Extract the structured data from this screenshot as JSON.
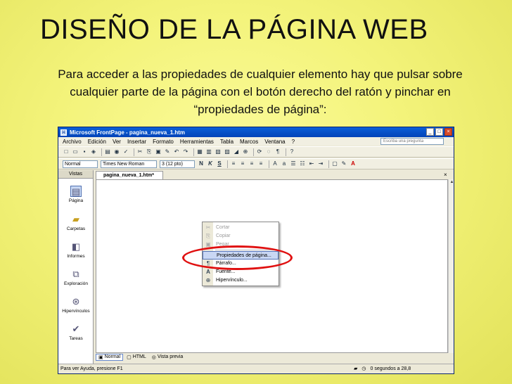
{
  "slide": {
    "title": "DISEÑO DE LA PÁGINA WEB",
    "text": "Para acceder a las propiedades de cualquier elemento hay que pulsar sobre cualquier parte de la página con el botón derecho del ratón y pinchar en “propiedades de página”:"
  },
  "window": {
    "title": "Microsoft FrontPage - pagina_nueva_1.htm",
    "min": "_",
    "max": "□",
    "close": "×"
  },
  "menubar": {
    "items": [
      "Archivo",
      "Edición",
      "Ver",
      "Insertar",
      "Formato",
      "Herramientas",
      "Tabla",
      "Marcos",
      "Ventana",
      "?"
    ],
    "ask_placeholder": "Escriba una pregunta"
  },
  "format_toolbar": {
    "style": "Normal",
    "font": "Times New Roman",
    "size": "3 (12 pto)",
    "bold": "N",
    "italic": "K",
    "underline": "S"
  },
  "views_panel": {
    "header": "Vistas",
    "items": [
      {
        "label": "Página",
        "icon": "page-view-icon",
        "glyph": "▤"
      },
      {
        "label": "Carpetas",
        "icon": "folders-view-icon",
        "glyph": "▰"
      },
      {
        "label": "Informes",
        "icon": "reports-view-icon",
        "glyph": "◧"
      },
      {
        "label": "Exploración",
        "icon": "navigation-view-icon",
        "glyph": "⧉"
      },
      {
        "label": "Hipervínculos",
        "icon": "hyperlinks-view-icon",
        "glyph": "⊛"
      },
      {
        "label": "Tareas",
        "icon": "tasks-view-icon",
        "glyph": "✔"
      }
    ]
  },
  "document": {
    "tab": "pagina_nueva_1.htm*",
    "close": "×"
  },
  "view_tabs": [
    "Normal",
    "HTML",
    "Vista previa"
  ],
  "status": {
    "left": "Para ver Ayuda, presione F1",
    "time": "0 segundos a 28,8"
  },
  "context_menu": {
    "items": [
      {
        "label": "Cortar",
        "icon": "scissors-icon",
        "glyph": "✂",
        "disabled": true
      },
      {
        "label": "Copiar",
        "icon": "copy-icon",
        "glyph": "⎘",
        "disabled": true
      },
      {
        "label": "Pegar",
        "icon": "paste-icon",
        "glyph": "▣",
        "disabled": true
      },
      {
        "label": "Propiedades de página...",
        "icon": "page-properties-icon",
        "glyph": "",
        "highlighted": true
      },
      {
        "label": "Párrafo...",
        "icon": "paragraph-icon",
        "glyph": "¶"
      },
      {
        "label": "Fuente...",
        "icon": "font-icon",
        "glyph": "A"
      },
      {
        "label": "Hipervínculo...",
        "icon": "hyperlink-icon",
        "glyph": "⊕"
      }
    ]
  },
  "colors": {
    "background": "#f3f37a",
    "highlight_oval": "#e01010",
    "menu_highlight": "#c9d7f4"
  }
}
